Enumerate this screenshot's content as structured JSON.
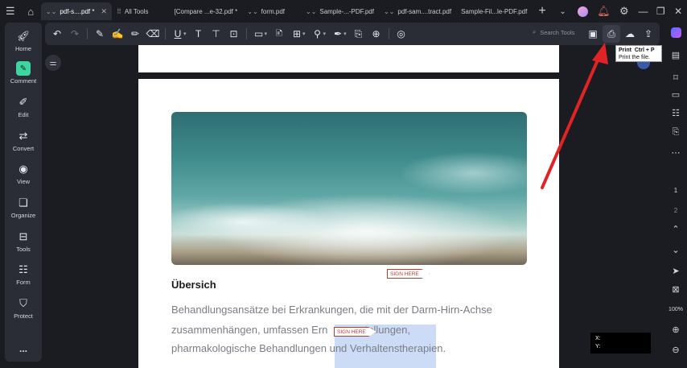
{
  "titlebar": {
    "tabs": [
      {
        "label": "pdf-s....pdf *",
        "active": true,
        "closable": true
      },
      {
        "label": "All Tools"
      },
      {
        "label": "[Compare ...e-32.pdf *"
      },
      {
        "label": "form.pdf"
      },
      {
        "label": "Sample-...-PDF.pdf"
      },
      {
        "label": "pdf-sam....tract.pdf"
      },
      {
        "label": "Sample-Fil...le-PDF.pdf"
      }
    ]
  },
  "sidebar": {
    "items": [
      {
        "label": "Home",
        "icon": "rocket-icon"
      },
      {
        "label": "Comment",
        "icon": "comment-icon",
        "active": true
      },
      {
        "label": "Edit",
        "icon": "edit-icon"
      },
      {
        "label": "Convert",
        "icon": "convert-icon"
      },
      {
        "label": "View",
        "icon": "eye-icon"
      },
      {
        "label": "Organize",
        "icon": "organize-icon"
      },
      {
        "label": "Tools",
        "icon": "toolbox-icon"
      },
      {
        "label": "Form",
        "icon": "form-icon"
      },
      {
        "label": "Protect",
        "icon": "shield-icon"
      }
    ],
    "more": "..."
  },
  "toolbar": {
    "search_label": "Search Tools"
  },
  "tooltip": {
    "title": "Print",
    "shortcut": "Ctrl + P",
    "description": "Print the file."
  },
  "document": {
    "heading": "Übersich",
    "lines": [
      "Behandlungsansätze bei Erkrankungen, die mit der Darm-Hirn-Achse",
      "zusammenhängen, umfassen Ern      umstellungen,",
      "pharmakologische Behandlungen und Verhaltenstherapien."
    ],
    "sign_tags": [
      "SIGN HERE",
      "SIGN HERE"
    ]
  },
  "right_rail": {
    "page_numbers": [
      "1",
      "2"
    ],
    "zoom": "100%"
  },
  "coords": {
    "x_label": "X:",
    "y_label": "Y:"
  },
  "colors": {
    "accent": "#3ed6a0",
    "arrow": "#e02424",
    "sign": "#c0392b"
  }
}
